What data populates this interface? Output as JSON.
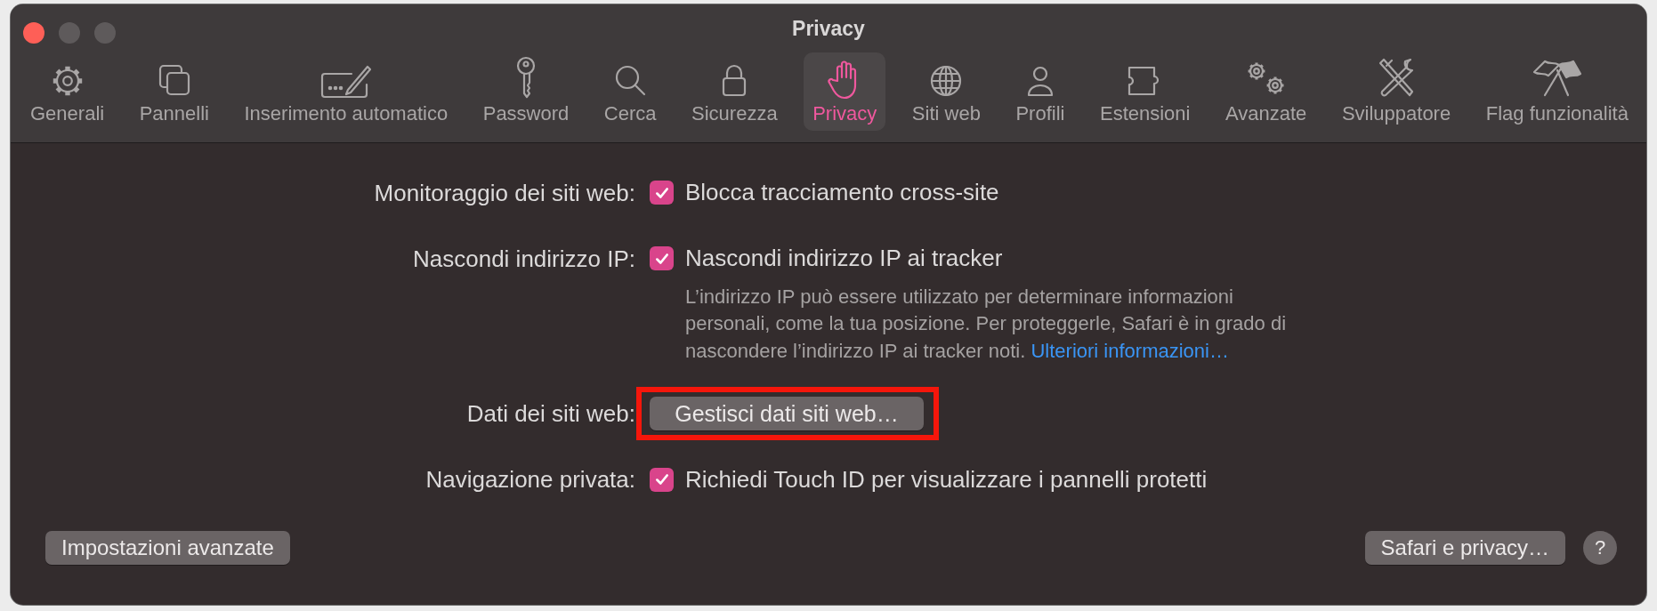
{
  "window": {
    "title": "Privacy"
  },
  "tabs": [
    {
      "label": "Generali",
      "selected": false
    },
    {
      "label": "Pannelli",
      "selected": false
    },
    {
      "label": "Inserimento automatico",
      "selected": false
    },
    {
      "label": "Password",
      "selected": false
    },
    {
      "label": "Cerca",
      "selected": false
    },
    {
      "label": "Sicurezza",
      "selected": false
    },
    {
      "label": "Privacy",
      "selected": true
    },
    {
      "label": "Siti web",
      "selected": false
    },
    {
      "label": "Profili",
      "selected": false
    },
    {
      "label": "Estensioni",
      "selected": false
    },
    {
      "label": "Avanzate",
      "selected": false
    },
    {
      "label": "Sviluppatore",
      "selected": false
    },
    {
      "label": "Flag funzionalità",
      "selected": false
    }
  ],
  "settings": [
    {
      "kind": "checkbox",
      "label": "Monitoraggio dei siti web:",
      "option": "Blocca tracciamento cross-site",
      "checked": true
    },
    {
      "kind": "checkbox",
      "label": "Nascondi indirizzo IP:",
      "option": "Nascondi indirizzo IP ai tracker",
      "checked": true,
      "description": "L’indirizzo IP può essere utilizzato per determinare informazioni personali, come la tua posizione. Per proteggerle, Safari è in grado di nascondere l’indirizzo IP ai tracker noti.",
      "link": "Ulteriori informazioni…"
    },
    {
      "kind": "button",
      "label": "Dati dei siti web:",
      "button": "Gestisci dati siti web…",
      "highlighted": true
    },
    {
      "kind": "checkbox",
      "label": "Navigazione privata:",
      "option": "Richiedi Touch ID per visualizzare i pannelli protetti",
      "checked": true
    }
  ],
  "footer": {
    "left_button": "Impostazioni avanzate",
    "right_button": "Safari e privacy…",
    "help": "?"
  }
}
